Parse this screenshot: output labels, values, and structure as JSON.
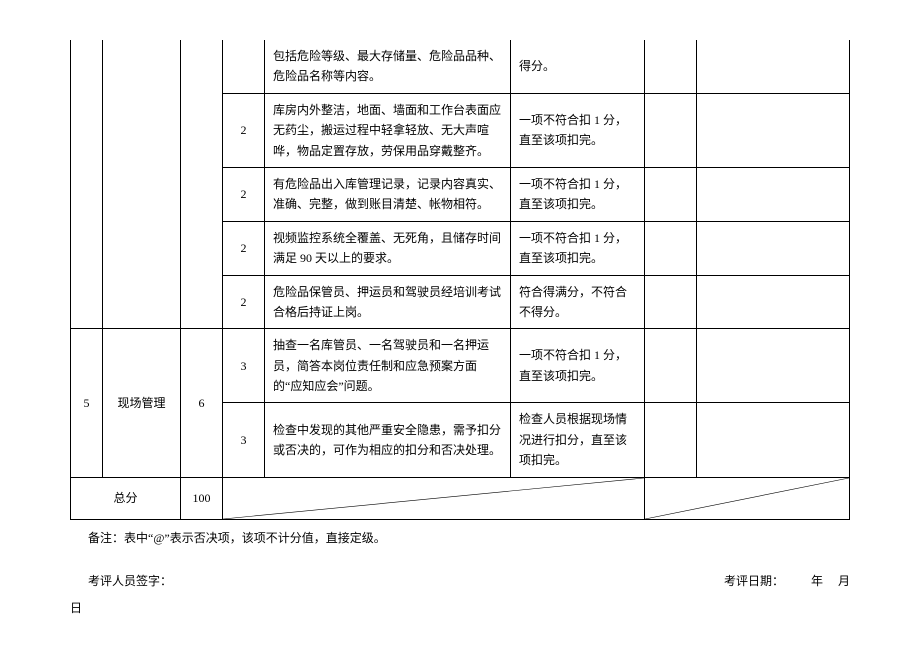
{
  "table": {
    "rows": [
      {
        "sub": "",
        "desc": "包括危险等级、最大存储量、危险品品种、危险品名称等内容。",
        "criteria": "得分。"
      },
      {
        "sub": "2",
        "desc": "库房内外整洁，地面、墙面和工作台表面应无药尘，搬运过程中轻拿轻放、无大声喧哗，物品定置存放，劳保用品穿戴整齐。",
        "criteria": "一项不符合扣 1 分，直至该项扣完。"
      },
      {
        "sub": "2",
        "desc": "有危险品出入库管理记录，记录内容真实、准确、完整，做到账目清楚、帐物相符。",
        "criteria": "一项不符合扣 1 分，直至该项扣完。"
      },
      {
        "sub": "2",
        "desc": "视频监控系统全覆盖、无死角，且储存时间满足 90 天以上的要求。",
        "criteria": "一项不符合扣 1 分，直至该项扣完。"
      },
      {
        "sub": "2",
        "desc": "危险品保管员、押运员和驾驶员经培训考试合格后持证上岗。",
        "criteria": "符合得满分，不符合不得分。"
      }
    ],
    "section5": {
      "idx": "5",
      "cat": "现场管理",
      "score": "6",
      "rows": [
        {
          "sub": "3",
          "desc": "抽查一名库管员、一名驾驶员和一名押运员，简答本岗位责任制和应急预案方面的“应知应会”问题。",
          "criteria": "一项不符合扣 1 分，直至该项扣完。"
        },
        {
          "sub": "3",
          "desc": "检查中发现的其他严重安全隐患，需予扣分或否决的，可作为相应的扣分和否决处理。",
          "criteria": "检查人员根据现场情况进行扣分，直至该项扣完。"
        }
      ]
    },
    "total": {
      "label": "总分",
      "value": "100"
    }
  },
  "footnote": "备注：表中“@”表示否决项，该项不计分值，直接定级。",
  "signature": {
    "left": "考评人员签字：",
    "right_label": "考评日期：",
    "year": "年",
    "month": "月",
    "day": "日"
  }
}
